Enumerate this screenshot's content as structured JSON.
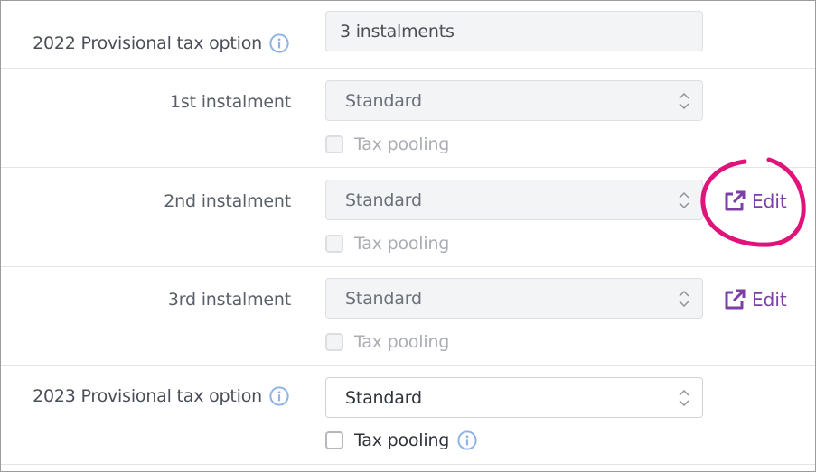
{
  "rows": [
    {
      "label": "2022 Provisional tax option",
      "has_info": true,
      "field_value": "3 instalments",
      "field_type": "readonly"
    },
    {
      "label": "1st instalment",
      "field_value": "Standard",
      "field_type": "select-disabled",
      "checkbox_label": "Tax pooling",
      "checkbox_checked": false
    },
    {
      "label": "2nd instalment",
      "field_value": "Standard",
      "field_type": "select-disabled",
      "checkbox_label": "Tax pooling",
      "checkbox_checked": false,
      "action_label": "Edit",
      "highlighted": true
    },
    {
      "label": "3rd instalment",
      "field_value": "Standard",
      "field_type": "select-disabled",
      "checkbox_label": "Tax pooling",
      "checkbox_checked": false,
      "action_label": "Edit"
    },
    {
      "label": "2023 Provisional tax option",
      "has_info": true,
      "field_value": "Standard",
      "field_type": "select",
      "checkbox_label": "Tax pooling",
      "checkbox_checked": false,
      "checkbox_has_info": true
    }
  ],
  "icons": {
    "info": "info-circle-icon",
    "chevron": "chevron-up-down-icon",
    "edit": "external-link-icon"
  },
  "colors": {
    "accent_purple": "#7b3fa6",
    "info_blue": "#8fb3e6",
    "annotation_pink": "#e0137a"
  }
}
